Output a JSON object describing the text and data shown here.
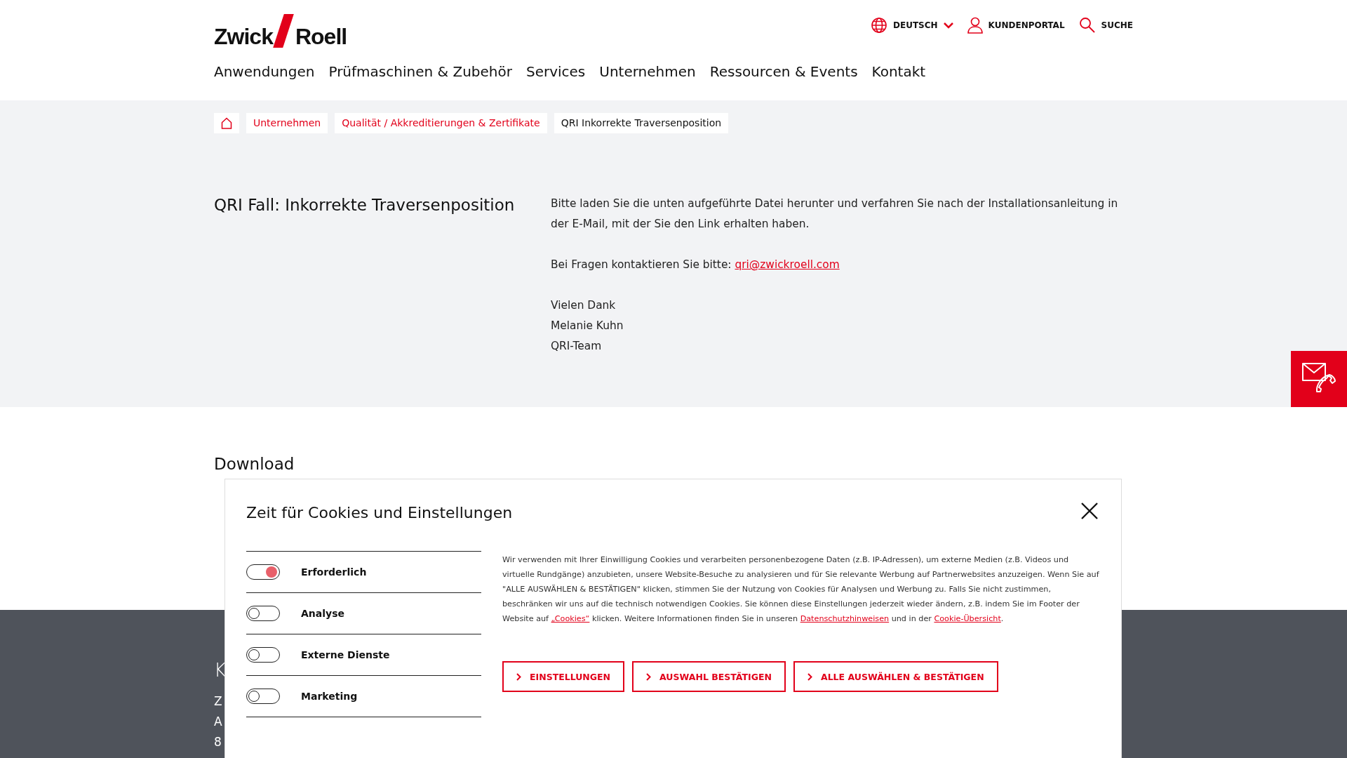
{
  "header": {
    "logo": {
      "left": "Zwick",
      "right": "Roell"
    },
    "utility": [
      {
        "kind": "language",
        "label": "DEUTSCH"
      },
      {
        "kind": "account",
        "label": "KUNDENPORTAL"
      },
      {
        "kind": "search",
        "label": "SUCHE"
      }
    ],
    "nav": [
      "Anwendungen",
      "Prüfmaschinen & Zubehör",
      "Services",
      "Unternehmen",
      "Ressourcen & Events",
      "Kontakt"
    ]
  },
  "breadcrumb": [
    {
      "kind": "home"
    },
    {
      "kind": "link",
      "label": "Unternehmen"
    },
    {
      "kind": "link",
      "label": "Qualität / Akkreditierungen & Zertifikate"
    },
    {
      "kind": "current",
      "label": "QRI Inkorrekte Traversenposition"
    }
  ],
  "article": {
    "title": "QRI Fall: Inkorrekte Traversenposition",
    "intro": "Bitte laden Sie die unten aufgeführte Datei herunter und verfahren Sie nach der Installationsanleitung in der E-Mail, mit der Sie den Link erhalten haben.",
    "contact_prefix": "Bei Fragen kontaktieren Sie bitte:",
    "contact_email": "qri@zwickroell.com",
    "signature": [
      "Vielen Dank",
      "Melanie Kuhn",
      "QRI-Team"
    ]
  },
  "download": {
    "title": "Download"
  },
  "footer": {
    "heading": "K",
    "lines": [
      "Z",
      "A",
      "8"
    ]
  },
  "cookie_dialog": {
    "title": "Zeit für Cookies und Einstellungen",
    "options": [
      {
        "label": "Erforderlich",
        "on": true
      },
      {
        "label": "Analyse",
        "on": false
      },
      {
        "label": "Externe Dienste",
        "on": false
      },
      {
        "label": "Marketing",
        "on": false
      }
    ],
    "text_parts": [
      {
        "kind": "text",
        "text": "Wir verwenden mit Ihrer Einwilligung Cookies und verarbeiten personenbezogene Daten (z.B. IP-Adressen), um externe Medien (z.B. Videos und virtuelle Rundgänge) anzubieten, unsere Website-Besuche zu analysieren und für Sie relevante Werbung auf Partnerwebsites anzuzeigen. Wenn Sie auf \"ALLE AUSWÄHLEN & BESTÄTIGEN\" klicken, stimmen Sie der Nutzung von Cookies für Analysen und Werbung zu. Falls Sie nicht zustimmen, beschränken wir uns auf die technisch notwendigen Cookies. Sie können diese Einstellungen jederzeit wieder ändern, z.B. indem Sie im Footer der Website auf "
      },
      {
        "kind": "link",
        "text": "„Cookies“"
      },
      {
        "kind": "text",
        "text": " klicken. Weitere Informationen finden Sie in unseren "
      },
      {
        "kind": "link",
        "text": "Datenschutzhinweisen"
      },
      {
        "kind": "text",
        "text": " und in der "
      },
      {
        "kind": "link",
        "text": "Cookie-Übersicht"
      },
      {
        "kind": "text",
        "text": "."
      }
    ],
    "buttons": [
      "EINSTELLUNGEN",
      "AUSWAHL BESTÄTIGEN",
      "ALLE AUSWÄHLEN & BESTÄTIGEN"
    ]
  }
}
